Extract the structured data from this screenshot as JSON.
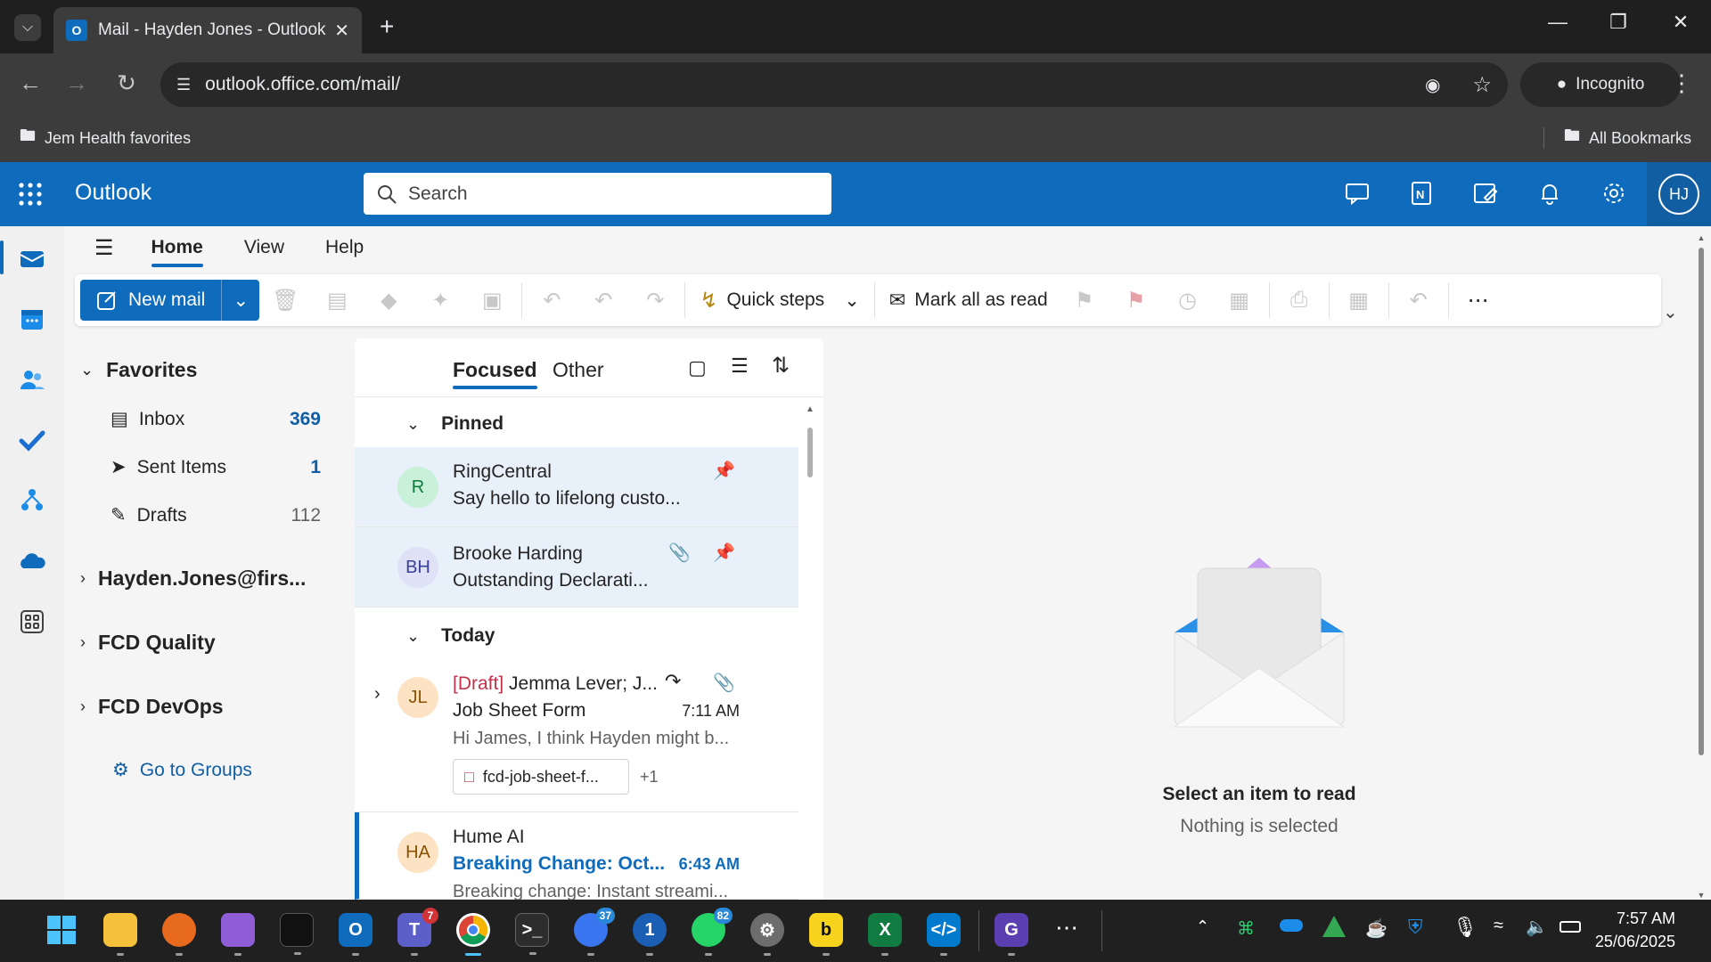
{
  "browser": {
    "tab_title": "Mail - Hayden Jones - Outlook",
    "url": "outlook.office.com/mail/",
    "incognito_label": "Incognito",
    "bookmarks_folder": "Jem Health favorites",
    "all_bookmarks": "All Bookmarks"
  },
  "header": {
    "app_name": "Outlook",
    "search_placeholder": "Search",
    "avatar_initials": "HJ"
  },
  "ribbon": {
    "tabs": [
      "Home",
      "View",
      "Help"
    ],
    "new_mail": "New mail",
    "quick_steps": "Quick steps",
    "mark_all_read": "Mark all as read"
  },
  "folders": {
    "favorites_label": "Favorites",
    "items": [
      {
        "label": "Inbox",
        "count": "369"
      },
      {
        "label": "Sent Items",
        "count": "1"
      },
      {
        "label": "Drafts",
        "count": "112"
      }
    ],
    "accounts": [
      "Hayden.Jones@firs...",
      "FCD Quality",
      "FCD DevOps"
    ],
    "go_to_groups": "Go to Groups"
  },
  "message_list": {
    "tab_focused": "Focused",
    "tab_other": "Other",
    "group_pinned": "Pinned",
    "group_today": "Today",
    "messages": [
      {
        "initials": "R",
        "sender": "RingCentral",
        "subject": "Say hello to lifelong custo...",
        "avatar_color": "#c9f0d8",
        "avatar_text_color": "#0e7a3d"
      },
      {
        "initials": "BH",
        "sender": "Brooke Harding",
        "subject": "Outstanding Declarati...",
        "avatar_color": "#dfe2f7",
        "avatar_text_color": "#3b3f9a"
      },
      {
        "initials": "JL",
        "draft_tag": "[Draft]",
        "sender": "Jemma Lever; J...",
        "subject": "Job Sheet Form",
        "time": "7:11 AM",
        "preview": "Hi James, I think Hayden might b...",
        "attachment": "fcd-job-sheet-f...",
        "more_attachments": "+1",
        "avatar_color": "#fde3c4",
        "avatar_text_color": "#8a5200"
      },
      {
        "initials": "HA",
        "sender": "Hume AI",
        "subject": "Breaking Change: Oct...",
        "time": "6:43 AM",
        "preview": "Breaking change: Instant streami...",
        "avatar_color": "#fde3c4",
        "avatar_text_color": "#8a5200"
      }
    ]
  },
  "reading_pane": {
    "title": "Select an item to read",
    "subtitle": "Nothing is selected"
  },
  "taskbar": {
    "teams_badge": "7",
    "signal_badge": "37",
    "whatsapp_badge": "82",
    "time": "7:57 AM",
    "date": "25/06/2025"
  },
  "colors": {
    "brand": "#0f6cbd",
    "unread_count": "#115ea3",
    "draft_red": "#c4314b",
    "unread_subject": "#0f6cbd"
  }
}
